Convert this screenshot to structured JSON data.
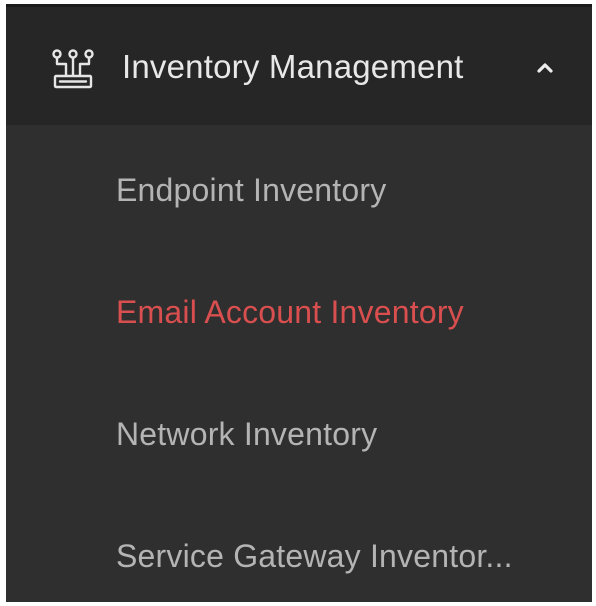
{
  "menu": {
    "header": {
      "label": "Inventory Management",
      "icon": "inventory-icon",
      "expanded": true,
      "chevron_icon": "chevron-up-icon"
    },
    "items": [
      {
        "label": "Endpoint Inventory",
        "active": false
      },
      {
        "label": "Email Account Inventory",
        "active": true
      },
      {
        "label": "Network Inventory",
        "active": false
      },
      {
        "label": "Service Gateway Inventor...",
        "active": false
      }
    ]
  },
  "colors": {
    "panel_background": "#2f2f2f",
    "header_background": "#262626",
    "header_text": "#e8e8e8",
    "item_text": "#b4b4b4",
    "active_text": "#d94f4f"
  }
}
